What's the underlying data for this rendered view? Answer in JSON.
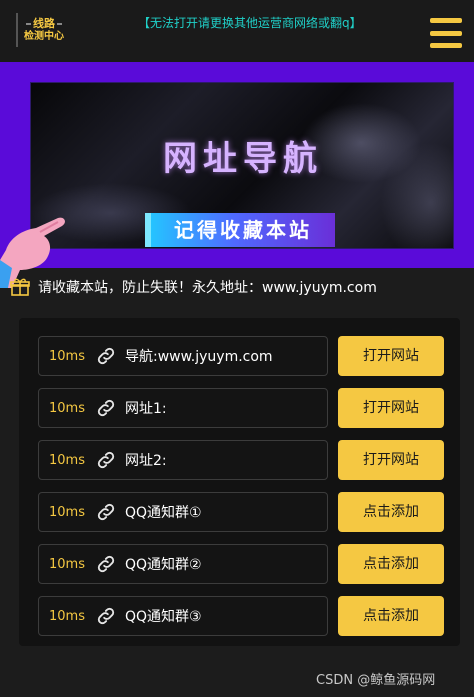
{
  "header": {
    "logo_line1": "线路",
    "logo_line2": "检测中心",
    "notice": "【无法打开请更换其他运营商网络或翻q】",
    "menu_icon": "hamburger-menu-icon",
    "accent": "#f5c842"
  },
  "banner": {
    "title": "网址导航",
    "subtitle": "记得收藏本站",
    "background": "#5a0bd9"
  },
  "bookmark": {
    "icon": "gift-icon",
    "text": "请收藏本站，防止失联！永久地址：www.jyuym.com"
  },
  "rows": [
    {
      "latency": "10ms",
      "label": "导航:www.jyuym.com",
      "button": "打开网站"
    },
    {
      "latency": "10ms",
      "label": "网址1:",
      "button": "打开网站"
    },
    {
      "latency": "10ms",
      "label": "网址2:",
      "button": "打开网站"
    },
    {
      "latency": "10ms",
      "label": "QQ通知群①",
      "button": "点击添加"
    },
    {
      "latency": "10ms",
      "label": "QQ通知群②",
      "button": "点击添加"
    },
    {
      "latency": "10ms",
      "label": "QQ通知群③",
      "button": "点击添加"
    }
  ],
  "watermark": "CSDN @鲸鱼源码网"
}
